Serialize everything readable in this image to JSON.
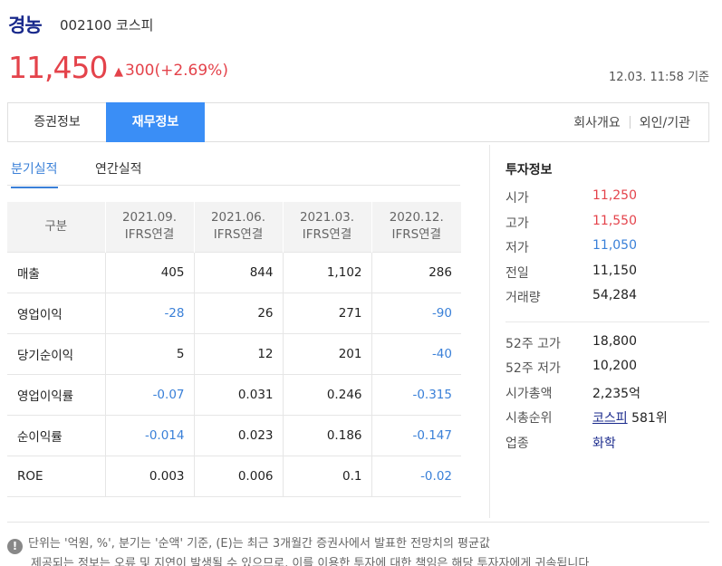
{
  "stock": {
    "name": "경농",
    "code_market": "002100 코스피",
    "price": "11,450",
    "change_arrow": "▲",
    "change": "300(+2.69%)",
    "timestamp": "12.03. 11:58 기준"
  },
  "tabs": {
    "securities": "증권정보",
    "financial": "재무정보",
    "company": "회사개요",
    "foreign": "외인/기관"
  },
  "subtabs": {
    "quarterly": "분기실적",
    "annual": "연간실적"
  },
  "table": {
    "header": [
      "구분",
      "2021.09.\nIFRS연결",
      "2021.06.\nIFRS연결",
      "2021.03.\nIFRS연결",
      "2020.12.\nIFRS연결"
    ],
    "rows": [
      {
        "label": "매출",
        "values": [
          "405",
          "844",
          "1,102",
          "286"
        ]
      },
      {
        "label": "영업이익",
        "values": [
          "-28",
          "26",
          "271",
          "-90"
        ]
      },
      {
        "label": "당기순이익",
        "values": [
          "5",
          "12",
          "201",
          "-40"
        ]
      },
      {
        "label": "영업이익률",
        "values": [
          "-0.07",
          "0.031",
          "0.246",
          "-0.315"
        ]
      },
      {
        "label": "순이익률",
        "values": [
          "-0.014",
          "0.023",
          "0.186",
          "-0.147"
        ]
      },
      {
        "label": "ROE",
        "values": [
          "0.003",
          "0.006",
          "0.1",
          "-0.02"
        ]
      }
    ]
  },
  "invest": {
    "title": "투자정보",
    "open_label": "시가",
    "open": "11,250",
    "high_label": "고가",
    "high": "11,550",
    "low_label": "저가",
    "low": "11,050",
    "prev_label": "전일",
    "prev": "11,150",
    "volume_label": "거래량",
    "volume": "54,284",
    "w52high_label": "52주 고가",
    "w52high": "18,800",
    "w52low_label": "52주 저가",
    "w52low": "10,200",
    "mcap_label": "시가총액",
    "mcap": "2,235억",
    "rank_label": "시총순위",
    "rank_market": "코스피",
    "rank": "581위",
    "sector_label": "업종",
    "sector": "화학"
  },
  "notice": {
    "icon": "!",
    "line1": "단위는 '억원, %', 분기는 '순액' 기준, (E)는 최근 3개월간 증권사에서 발표한 전망치의 평균값",
    "line2": "제공되는 정보는 오류 및 지연이 발생될 수 있으므로, 이를 이용한 투자에 대한 책임은 해당 투자자에게 귀속됩니다"
  },
  "colors": {
    "up": "#e4434b",
    "down": "#3a80d8",
    "accent": "#3a8ef6",
    "brand": "#1a2a8c"
  }
}
